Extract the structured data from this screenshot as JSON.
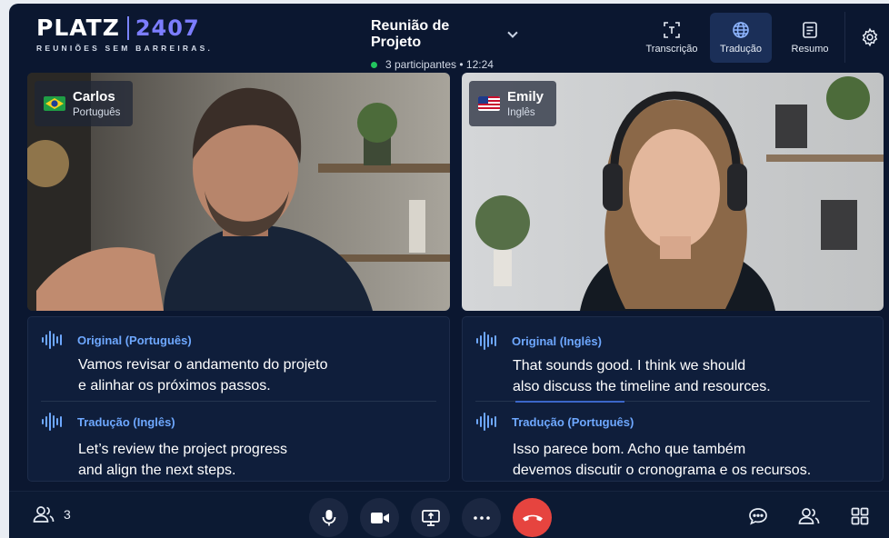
{
  "brand": {
    "name": "PLATZ",
    "number": "2407",
    "tagline": "REUNIÕES SEM BARREIRAS."
  },
  "meeting": {
    "title": "Reunião de Projeto",
    "status": "3 participantes • 12:24"
  },
  "tools": [
    {
      "label": "Transcrição",
      "icon": "transcription-icon",
      "active": false
    },
    {
      "label": "Tradução",
      "icon": "globe-icon",
      "active": true
    },
    {
      "label": "Resumo",
      "icon": "summary-icon",
      "active": false
    }
  ],
  "participants": [
    {
      "name": "Carlos",
      "language": "Português",
      "flag": "brazil-flag"
    },
    {
      "name": "Emily",
      "language": "Inglês",
      "flag": "usa-flag"
    }
  ],
  "captions": [
    {
      "original_label": "Original (Português)",
      "original_text_1": "Vamos revisar o andamento do projeto",
      "original_text_2": "e alinhar os próximos passos.",
      "translation_label": "Tradução (Inglês)",
      "translation_text_1": "Let’s review the project progress",
      "translation_text_2": "and align the next steps."
    },
    {
      "original_label": "Original (Inglês)",
      "original_text_1": "That sounds good. I think we should",
      "original_text_2": "also discuss the timeline and resources.",
      "translation_label": "Tradução (Português)",
      "translation_text_1": "Isso parece bom. Acho que também",
      "translation_text_2": "devemos discutir o cronograma e os recursos."
    }
  ],
  "bottom": {
    "participant_count": "3"
  },
  "colors": {
    "accent": "#6ea8ff",
    "end_call": "#e6443f",
    "live": "#22c55e",
    "background": "#0b1730"
  }
}
